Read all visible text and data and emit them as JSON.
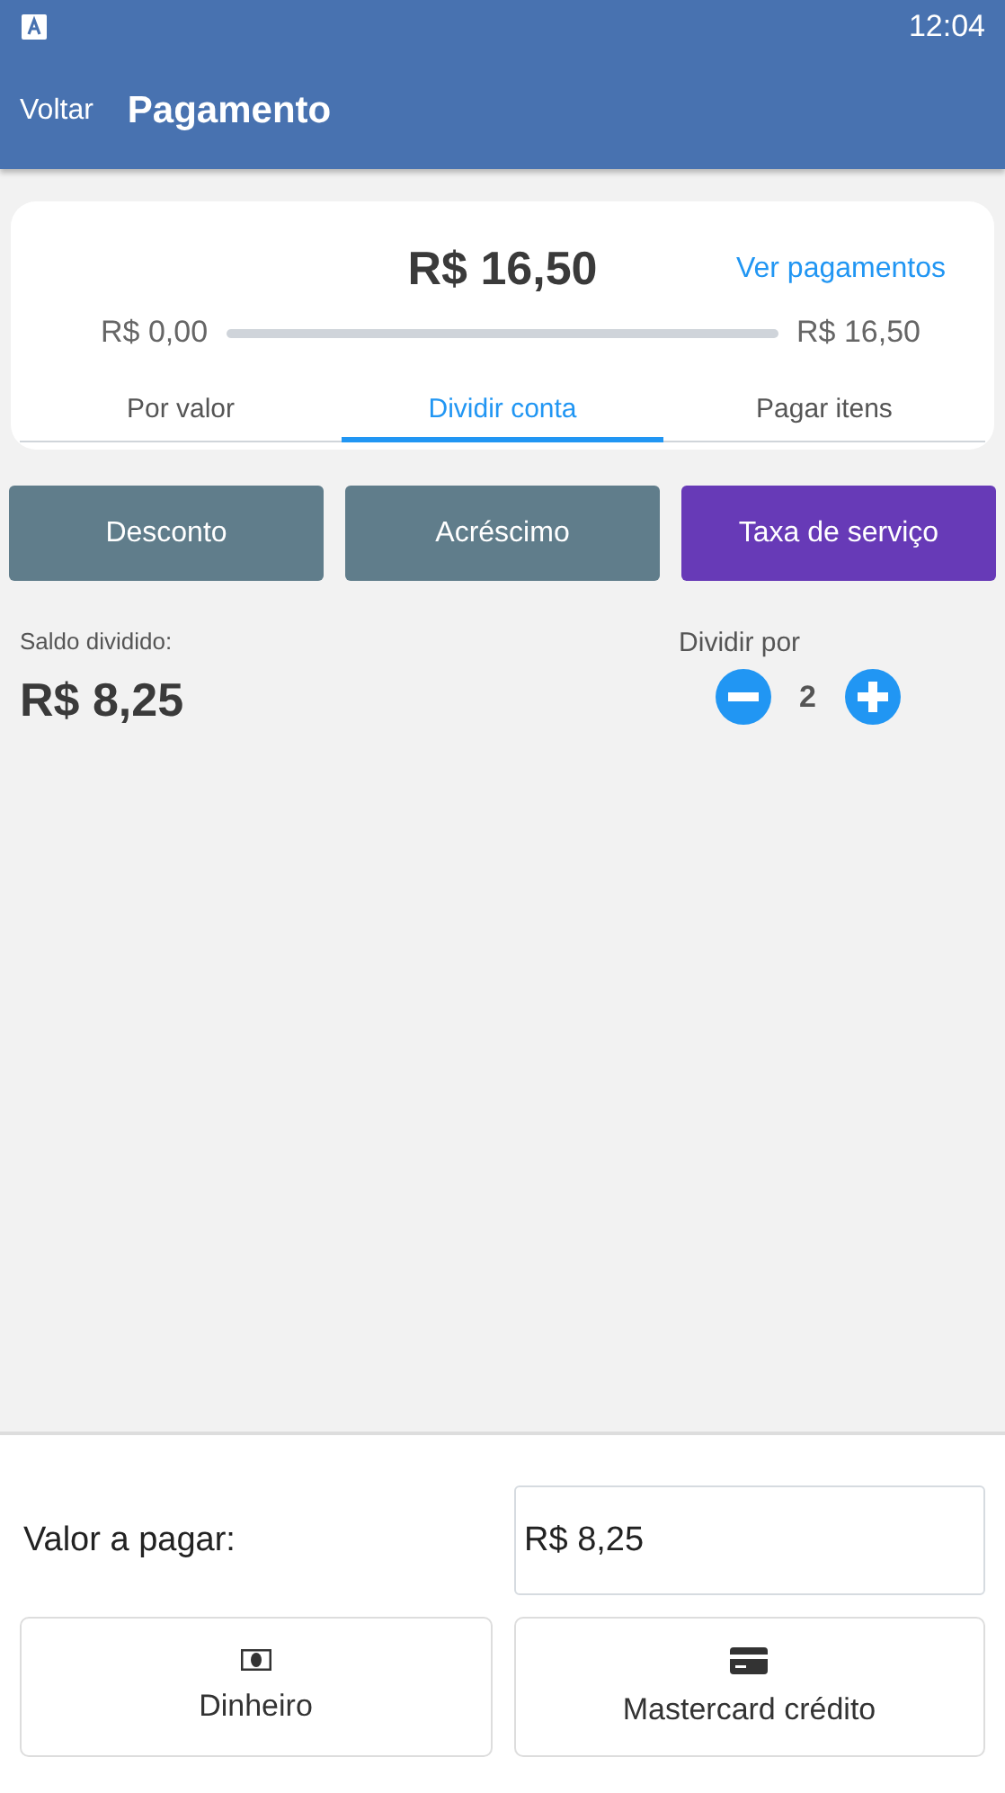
{
  "status_bar": {
    "time": "12:04"
  },
  "app_bar": {
    "back": "Voltar",
    "title": "Pagamento"
  },
  "summary": {
    "total": "R$ 16,50",
    "link": "Ver pagamentos",
    "paid": "R$ 0,00",
    "goal": "R$ 16,50",
    "level": 0
  },
  "tabs": [
    {
      "label": "Por valor",
      "selected": false
    },
    {
      "label": "Dividir conta",
      "selected": true
    },
    {
      "label": "Pagar itens",
      "selected": false
    }
  ],
  "adjustments": [
    {
      "label": "Desconto",
      "active": false
    },
    {
      "label": "Acréscimo",
      "active": false
    },
    {
      "label": "Taxa de serviço",
      "active": true
    }
  ],
  "split": {
    "label": "Saldo dividido:",
    "amount": "R$ 8,25",
    "divide_label": "Dividir por",
    "count": "2"
  },
  "payment": {
    "label": "Valor a pagar:",
    "value": "R$ 8,25"
  },
  "methods": [
    {
      "kind": "cash",
      "label": "Dinheiro"
    },
    {
      "kind": "card",
      "label": "Mastercard crédito"
    }
  ]
}
